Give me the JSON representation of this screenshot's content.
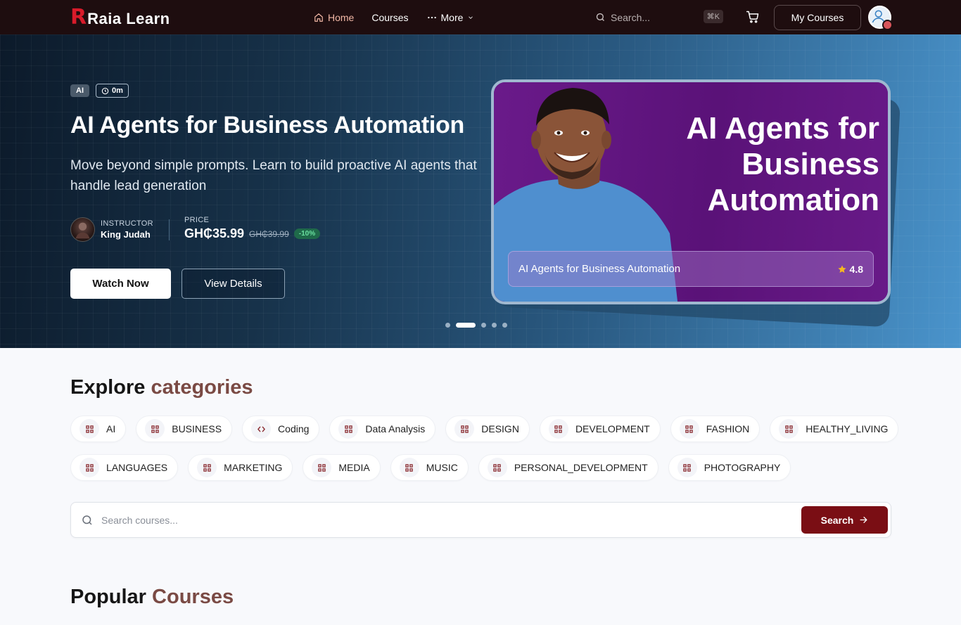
{
  "nav": {
    "logo_mark": "R",
    "logo_text": "Raia Learn",
    "links": [
      {
        "label": "Home",
        "icon": "home-icon",
        "active": true
      },
      {
        "label": "Courses"
      },
      {
        "label": "More",
        "icon": "ellipsis-icon"
      }
    ],
    "search_placeholder": "Search...",
    "search_shortcut": "⌘K",
    "my_courses_label": "My Courses",
    "accent_color": "#f2b8a6",
    "bg_color": "#1e0d0f"
  },
  "hero": {
    "category_tag": "AI",
    "duration": "0m",
    "title": "AI Agents for Business Automation",
    "description": "Move beyond simple prompts. Learn to build proactive AI agents that handle lead generation",
    "instructor_label": "INSTRUCTOR",
    "instructor_name": "King Judah",
    "price_label": "PRICE",
    "price": "GH₵35.99",
    "old_price": "GH₵39.99",
    "discount": "-10%",
    "watch_label": "Watch Now",
    "details_label": "View Details",
    "slide_count": 5,
    "active_slide": 1,
    "card": {
      "headline": "AI Agents for Business Automation",
      "footer_title": "AI Agents for Business Automation",
      "rating": "4.8"
    }
  },
  "categories": {
    "title_plain": "Explore",
    "title_accent": "categories",
    "rows": [
      [
        {
          "label": "AI",
          "icon": "grid-icon"
        },
        {
          "label": "BUSINESS",
          "icon": "grid-icon"
        },
        {
          "label": "Coding",
          "icon": "code-icon"
        },
        {
          "label": "Data Analysis",
          "icon": "grid-icon"
        },
        {
          "label": "DESIGN",
          "icon": "grid-icon"
        },
        {
          "label": "DEVELOPMENT",
          "icon": "grid-icon"
        },
        {
          "label": "FASHION",
          "icon": "grid-icon"
        },
        {
          "label": "HEALTHY_LIVING",
          "icon": "grid-icon"
        }
      ],
      [
        {
          "label": "LANGUAGES",
          "icon": "grid-icon"
        },
        {
          "label": "MARKETING",
          "icon": "grid-icon"
        },
        {
          "label": "MEDIA",
          "icon": "grid-icon"
        },
        {
          "label": "MUSIC",
          "icon": "grid-icon"
        },
        {
          "label": "PERSONAL_DEVELOPMENT",
          "icon": "grid-icon"
        },
        {
          "label": "PHOTOGRAPHY",
          "icon": "grid-icon"
        }
      ]
    ],
    "accent_color": "#7a4a44",
    "icon_color": "#8a2a30"
  },
  "search": {
    "placeholder": "Search courses...",
    "button_label": "Search",
    "button_color": "#7a0e14"
  },
  "popular": {
    "title_plain": "Popular",
    "title_accent": "Courses"
  }
}
